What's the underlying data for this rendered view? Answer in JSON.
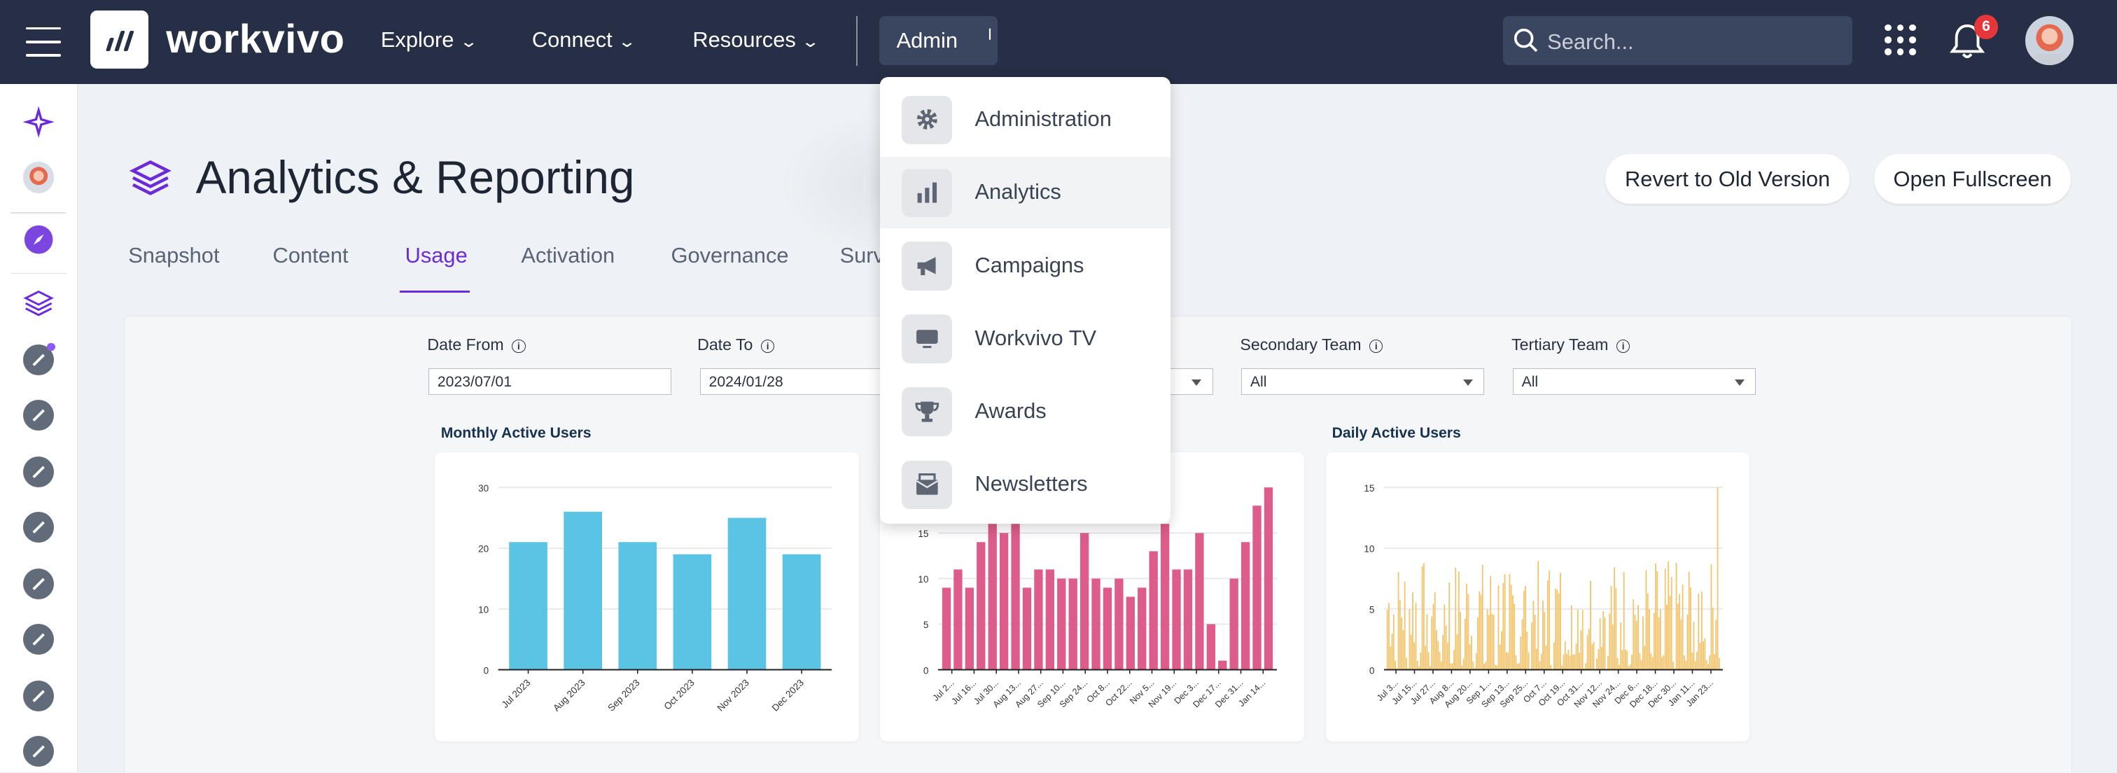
{
  "brand": "workvivo",
  "nav": {
    "explore": "Explore",
    "connect": "Connect",
    "resources": "Resources",
    "admin": "Admin"
  },
  "search": {
    "placeholder": "Search..."
  },
  "notifications": {
    "count": "6"
  },
  "page": {
    "title": "Analytics & Reporting",
    "revert_button": "Revert to Old Version",
    "fullscreen_button": "Open Fullscreen"
  },
  "tabs": [
    {
      "label": "Snapshot"
    },
    {
      "label": "Content"
    },
    {
      "label": "Usage",
      "active": true
    },
    {
      "label": "Activation"
    },
    {
      "label": "Governance"
    },
    {
      "label": "Surv"
    }
  ],
  "filters": {
    "date_from": {
      "label": "Date From",
      "value": "2023/07/01"
    },
    "date_to": {
      "label": "Date To",
      "value": "2024/01/28"
    },
    "secondary_team": {
      "label": "Secondary Team",
      "value": "All"
    },
    "tertiary_team": {
      "label": "Tertiary Team",
      "value": "All"
    }
  },
  "admin_menu": [
    {
      "label": "Administration",
      "icon": "gear-icon"
    },
    {
      "label": "Analytics",
      "icon": "bar-chart-icon",
      "highlighted": true
    },
    {
      "label": "Campaigns",
      "icon": "megaphone-icon"
    },
    {
      "label": "Workvivo TV",
      "icon": "monitor-icon"
    },
    {
      "label": "Awards",
      "icon": "trophy-icon"
    },
    {
      "label": "Newsletters",
      "icon": "newsletter-icon"
    }
  ],
  "colors": {
    "topbar": "#262f45",
    "accent": "#6c2bd9",
    "monthly_bar": "#5bc4e5",
    "weekly_bar": "#dd5c8a",
    "daily_bar": "#f2c46b"
  },
  "chart_data": [
    {
      "type": "bar",
      "title": "Monthly Active Users",
      "categories": [
        "Jul 2023",
        "Aug 2023",
        "Sep 2023",
        "Oct 2023",
        "Nov 2023",
        "Dec 2023"
      ],
      "values": [
        21,
        26,
        21,
        19,
        25,
        19
      ],
      "ylim": [
        0,
        30
      ],
      "yticks": [
        "0",
        "10",
        "20",
        "30"
      ]
    },
    {
      "type": "bar",
      "title": "",
      "tick_labels": [
        "Jul 2...",
        "Jul 16...",
        "Jul 30...",
        "Aug 13...",
        "Aug 27...",
        "Sep 10...",
        "Sep 24...",
        "Oct 8...",
        "Oct 22...",
        "Nov 5...",
        "Nov 19...",
        "Dec 3...",
        "Dec 17...",
        "Dec 31...",
        "Jan 14..."
      ],
      "values": [
        9,
        11,
        9,
        14,
        16,
        15,
        16,
        9,
        11,
        11,
        10,
        10,
        15,
        10,
        9,
        10,
        8,
        9,
        13,
        16,
        11,
        11,
        15,
        5,
        1,
        10,
        14,
        18,
        20
      ],
      "ylim": [
        0,
        20
      ],
      "yticks": [
        "0",
        "5",
        "10",
        "15"
      ]
    },
    {
      "type": "bar",
      "title": "Daily Active Users",
      "tick_labels": [
        "Jul 3...",
        "Jul 15...",
        "Jul 27...",
        "Aug 8...",
        "Aug 20...",
        "Sep 1...",
        "Sep 13...",
        "Sep 25...",
        "Oct 7...",
        "Oct 19...",
        "Oct 31...",
        "Nov 12...",
        "Nov 24...",
        "Dec 6...",
        "Dec 18...",
        "Dec 30...",
        "Jan 11...",
        "Jan 23..."
      ],
      "ylim": [
        0,
        15
      ],
      "yticks": [
        "0",
        "5",
        "10",
        "15"
      ]
    }
  ]
}
